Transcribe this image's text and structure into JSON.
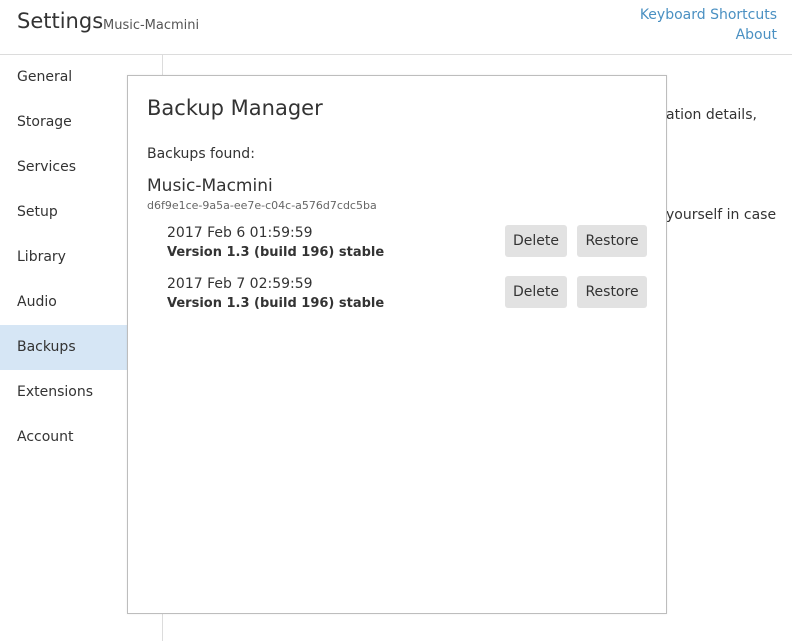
{
  "header": {
    "title": "Settings",
    "subtitle": "Music-Macmini",
    "links": [
      "Keyboard Shortcuts",
      "About"
    ]
  },
  "sidebar": {
    "items": [
      {
        "label": "General"
      },
      {
        "label": "Storage"
      },
      {
        "label": "Services"
      },
      {
        "label": "Setup"
      },
      {
        "label": "Library"
      },
      {
        "label": "Audio"
      },
      {
        "label": "Backups",
        "active": true
      },
      {
        "label": "Extensions"
      },
      {
        "label": "Account"
      }
    ]
  },
  "background": {
    "fragment_1": "ation details,",
    "fragment_2": "yourself in case"
  },
  "modal": {
    "title": "Backup Manager",
    "backups_found_label": "Backups found:",
    "machine": {
      "name": "Music-Macmini",
      "id": "d6f9e1ce-9a5a-ee7e-c04c-a576d7cdc5ba"
    },
    "backups": [
      {
        "date": "2017 Feb 6 01:59:59",
        "version": "Version 1.3 (build 196) stable",
        "delete_label": "Delete",
        "restore_label": "Restore"
      },
      {
        "date": "2017 Feb 7 02:59:59",
        "version": "Version 1.3 (build 196) stable",
        "delete_label": "Delete",
        "restore_label": "Restore"
      }
    ]
  },
  "colors": {
    "accent_link": "#4a90c2",
    "sidebar_active": "#d6e6f5",
    "button_bg": "#e2e2e2"
  }
}
